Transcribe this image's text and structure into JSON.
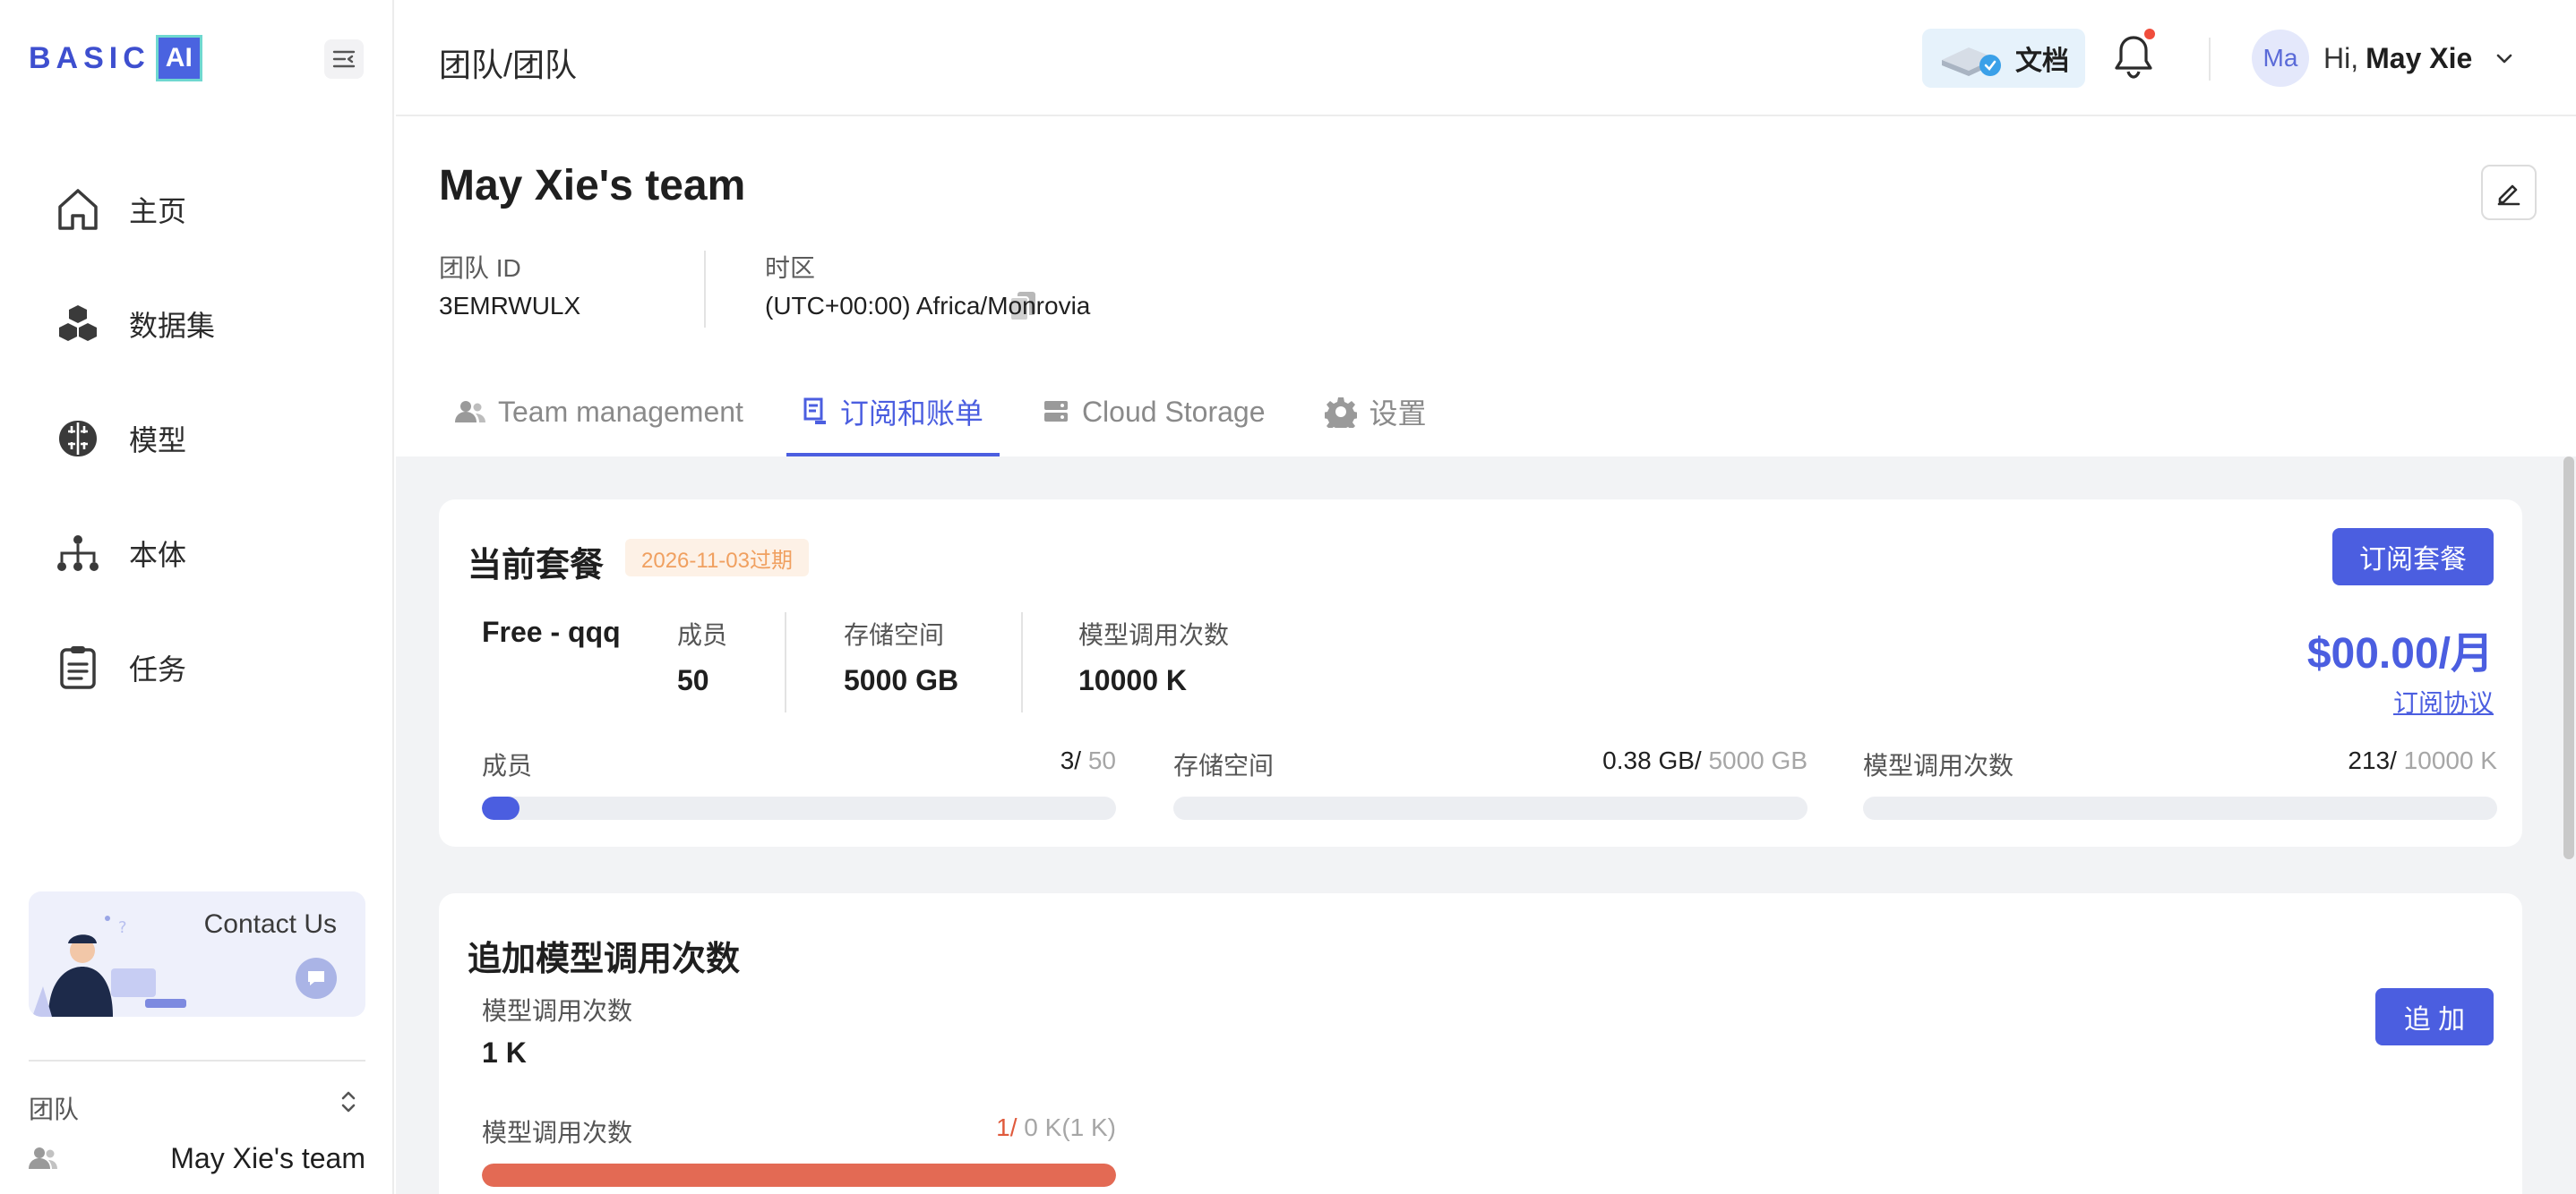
{
  "logo": {
    "text": "BASIC",
    "highlight": "AI"
  },
  "sidebar": {
    "items": [
      {
        "label": "主页",
        "icon": "home-icon"
      },
      {
        "label": "数据集",
        "icon": "dataset-icon"
      },
      {
        "label": "模型",
        "icon": "brain-icon"
      },
      {
        "label": "本体",
        "icon": "hierarchy-icon"
      },
      {
        "label": "任务",
        "icon": "clipboard-icon"
      }
    ],
    "contact_us": "Contact Us",
    "team_section_label": "团队",
    "team_name": "May Xie's team"
  },
  "header": {
    "breadcrumb": "团队/团队",
    "docs_label": "文档",
    "greeting": "Hi,",
    "user_name": "May Xie",
    "avatar_initials": "Ma",
    "has_notification": true
  },
  "team": {
    "title": "May Xie's team",
    "id_label": "团队 ID",
    "id_value": "3EMRWULX",
    "timezone_label": "时区",
    "timezone_value": "(UTC+00:00) Africa/Monrovia"
  },
  "tabs": [
    {
      "label": "Team management",
      "icon": "team-icon",
      "active": false
    },
    {
      "label": "订阅和账单",
      "icon": "billing-icon",
      "active": true
    },
    {
      "label": "Cloud Storage",
      "icon": "storage-icon",
      "active": false
    },
    {
      "label": "设置",
      "icon": "gear-icon",
      "active": false
    }
  ],
  "plan": {
    "title": "当前套餐",
    "expire_badge": "2026-11-03过期",
    "subscribe_button": "订阅套餐",
    "name": "Free - qqq",
    "specs": [
      {
        "label": "成员",
        "value": "50"
      },
      {
        "label": "存储空间",
        "value": "5000 GB"
      },
      {
        "label": "模型调用次数",
        "value": "10000 K"
      }
    ],
    "price": "$00.00/月",
    "agreement_link": "订阅协议",
    "usage": [
      {
        "label": "成员",
        "used": "3/",
        "total": " 50",
        "fraction": 0.06
      },
      {
        "label": "存储空间",
        "used": "0.38 GB/",
        "total": " 5000 GB",
        "fraction": 0.0
      },
      {
        "label": "模型调用次数",
        "used": "213/",
        "total": " 10000 K",
        "fraction": 0.0
      }
    ]
  },
  "addon": {
    "title": "追加模型调用次数",
    "add_button": "追 加",
    "label": "模型调用次数",
    "value": "1 K",
    "usage": {
      "label": "模型调用次数",
      "used": "1/",
      "total": " 0 K(1 K)",
      "fraction": 1.0
    }
  },
  "colors": {
    "accent": "#4b5ee0",
    "danger": "#e36a54",
    "badge_text": "#f0a060",
    "badge_bg": "#fdf1e6"
  }
}
